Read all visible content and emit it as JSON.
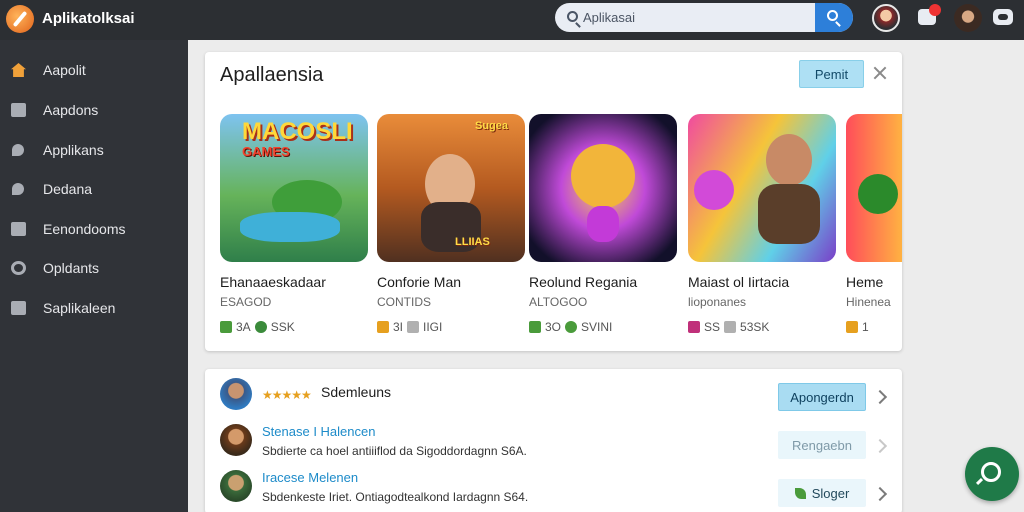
{
  "app": {
    "title": "Aplikatolksai"
  },
  "search": {
    "placeholder": "Aplikasai"
  },
  "sidebar": {
    "items": [
      {
        "label": "Aapolit",
        "icon": "home-icon"
      },
      {
        "label": "Aapdons",
        "icon": "grid-icon"
      },
      {
        "label": "Applikans",
        "icon": "pin-icon"
      },
      {
        "label": "Dedana",
        "icon": "pin-icon"
      },
      {
        "label": "Eenondooms",
        "icon": "folder-icon"
      },
      {
        "label": "Opldants",
        "icon": "gear-icon"
      },
      {
        "label": "Saplikaleen",
        "icon": "card-icon"
      }
    ]
  },
  "featured": {
    "title": "Apallaensia",
    "action_label": "Pemit",
    "tiles": [
      {
        "thumb_title": "MACOSLI",
        "thumb_subtitle": "GAMES",
        "name": "Ehanaaeskadaar",
        "subtitle": "ESAGOD",
        "stat1": "3A",
        "stat2": "SSK"
      },
      {
        "thumb_logo": "Sugea",
        "thumb_tag": "LLIIAS",
        "name": "Conforie Man",
        "subtitle": "CONTIDS",
        "stat1": "3I",
        "stat2": "IIGI"
      },
      {
        "name": "Reolund Regania",
        "subtitle": "ALTOGOO",
        "stat1": "3O",
        "stat2": "SVINI"
      },
      {
        "name": "Maiast ol Iirtacia",
        "subtitle": "lioponanes",
        "stat1": "SS",
        "stat2": "53SK"
      },
      {
        "name": "Heme",
        "subtitle": "Hinenea",
        "stat1": "1",
        "stat2": ""
      }
    ]
  },
  "list": {
    "top": {
      "stars": "★★★★★",
      "title": "Sdemleuns",
      "button": "Apongerdn"
    },
    "rows": [
      {
        "title": "Stenase I Halencen",
        "desc": "Sbdierte ca hoel antiiiflod da Sigoddordagnn  S6A.",
        "button": "Rengaebn"
      },
      {
        "title": "Iracese Melenen",
        "desc": "Sbdenkeste Iriet. Ontiagodtealkond Iardagnn  S64.",
        "button": "Sloger"
      }
    ]
  },
  "colors": {
    "accent": "#2d7fd9",
    "sidebar": "#303338",
    "topbar": "#2c2f33",
    "fab": "#1f7a48"
  }
}
